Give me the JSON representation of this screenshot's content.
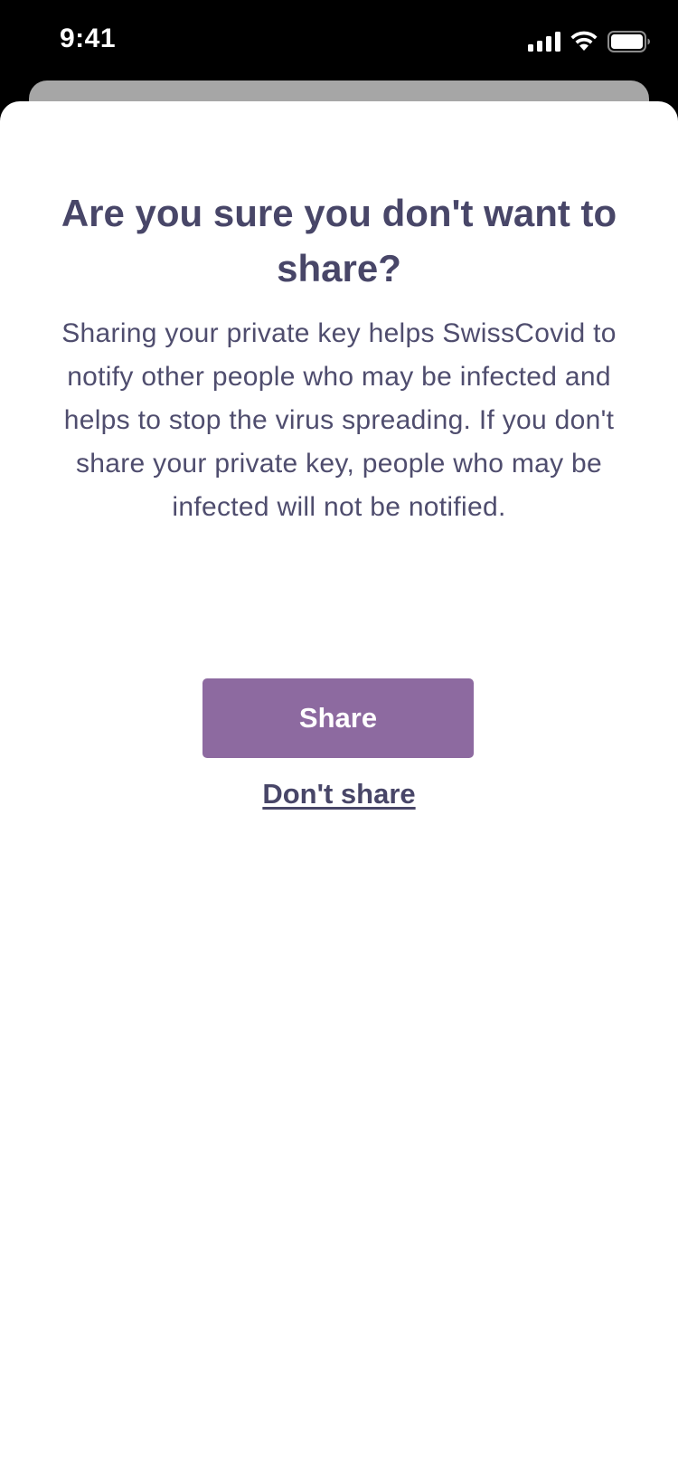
{
  "status_bar": {
    "time": "9:41",
    "icons": [
      "cellular-signal-icon",
      "wifi-icon",
      "battery-icon"
    ]
  },
  "dialog": {
    "title": "Are you sure you don't want to share?",
    "body": "Sharing your private key helps SwissCovid to notify other people who may be infected and helps to stop the virus spreading. If you don't share your private key, people who may be infected will not be notified.",
    "primary_button_label": "Share",
    "secondary_link_label": "Don't share"
  },
  "colors": {
    "text_primary": "#484668",
    "accent_button": "#8d6aa0",
    "sheet_background": "#ffffff",
    "status_bar_background": "#000000"
  }
}
